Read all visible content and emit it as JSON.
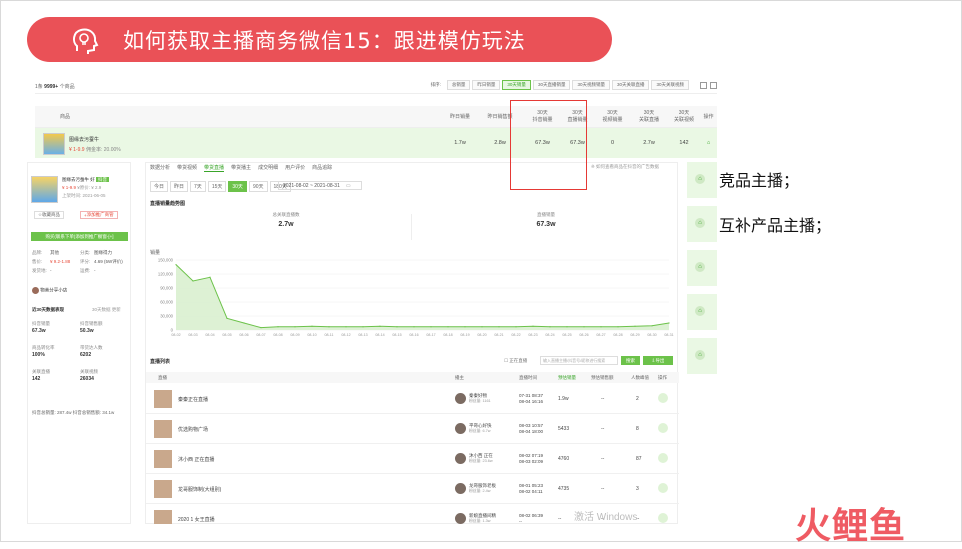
{
  "title": "如何获取主播商务微信15：跟进模仿玩法",
  "side_notes": [
    "竞品主播；",
    "互补产品主播；"
  ],
  "logo_text": "火鲤鱼",
  "watermark": "激活 Windows",
  "top_table": {
    "count_label": "1条",
    "count_value": "9999+",
    "count_suffix": "个商品",
    "sort_label": "排序:",
    "sort_tabs": [
      "总销量",
      "昨日销量",
      "30天销量",
      "30天直播销量",
      "30天视频销量",
      "30天关联直播",
      "30天关联视频"
    ],
    "active_sort": "30天销量",
    "headers": [
      "商品",
      "昨日销量",
      "昨日销售额",
      "30天\n抖音销量",
      "30天\n直播销量",
      "30天\n视频销量",
      "30天\n关联直播",
      "30天\n关联视频",
      "操作"
    ],
    "row": {
      "name": "图缘去污蚕牛",
      "price": "¥ 1-9.9",
      "commission": "佣金率: 20.00%",
      "values": [
        "1.7w",
        "2.8w",
        "67.3w",
        "67.3w",
        "0",
        "2.7w",
        "142"
      ]
    }
  },
  "left_panel": {
    "product_name": "图缘去污蚕牛 好",
    "badge": "抖音",
    "price": "¥ 1-9.9",
    "price_ref": "¥原价: ¥ 2.9",
    "listing": "上架时间: 2021-06-05",
    "fav_label": "收藏商品",
    "promo_label": "添加推广商管",
    "green_bar": "购买(联系下单)添加到推广橱窗-[+]",
    "rows": [
      [
        "品牌:",
        "其他",
        "分类:",
        "图缘得力"
      ],
      [
        "售价:",
        "¥ 9.2-1.88",
        "评分:",
        "4.69 (5W评价)"
      ],
      [
        "发货地:",
        "-",
        "运费:",
        "-"
      ]
    ],
    "shop": "物美分享小店",
    "section_title": "近30天数据表现",
    "section_note": "30天数据 更新",
    "stats": [
      {
        "label": "抖音销量",
        "value": "67.3w"
      },
      {
        "label": "抖音销售额",
        "value": "50.3w"
      },
      {
        "label": "商品转化率",
        "value": "100%"
      },
      {
        "label": "带货达人数",
        "value": "6202"
      },
      {
        "label": "关联直播",
        "value": "142"
      },
      {
        "label": "关联视频",
        "value": "26034"
      }
    ],
    "footer": "抖音总销量: 287.4w  抖音总销售额: 34.1w"
  },
  "center_panel": {
    "tabs": [
      "数据分析",
      "带货视频",
      "带货直播",
      "带货播主",
      "成交明细",
      "用户评价",
      "商品追踪"
    ],
    "active_tab": "带货直播",
    "hint": "※ 如何查看商品在抖音的广告数据",
    "date_buttons": [
      "今日",
      "昨日",
      "7天",
      "15天",
      "30天",
      "90天",
      "180天"
    ],
    "active_date": "30天",
    "date_range": "2021-08-02  ~  2021-08-31",
    "chart_title": "直播销量趋势图",
    "stat_a_label": "总关联直播数",
    "stat_a_value": "2.7w",
    "stat_b_label": "直播销量",
    "stat_b_value": "67.3w",
    "list_title": "直播列表",
    "live_filter": "正在直播",
    "search_placeholder": "输入直播主播/抖音号/昵称进行搜索",
    "search_btn": "搜索",
    "export_btn": "导出",
    "list_headers": [
      "直播",
      "播主",
      "直播时间",
      "预估销量",
      "预估销售额",
      "人数峰值",
      "操作"
    ],
    "list_rows": [
      {
        "title": "秦秦正在直播",
        "host": "秦秦好物",
        "fans": "粉丝量: 1161",
        "time": "07-31 08:37\n08-04 16:16",
        "sales": "1.9w",
        "amount": "--",
        "peak": "2"
      },
      {
        "title": "优选购物广场",
        "host": "平哥心好快",
        "fans": "粉丝量: 6.7w",
        "time": "08-03 10:57\n08-04 18:00",
        "sales": "5433",
        "amount": "--",
        "peak": "8"
      },
      {
        "title": "沐小西 正在直播",
        "host": "沐小西 正在",
        "fans": "粉丝量: 23.6w",
        "time": "08-02 07:19\n08-03 02:09",
        "sales": "4760",
        "amount": "--",
        "peak": "87"
      },
      {
        "title": "龙哥服饰制(大组别)",
        "host": "龙哥服饰老板",
        "fans": "粉丝量: 2.4w",
        "time": "08-01 05:23\n08-02 04:11",
        "sales": "4735",
        "amount": "--",
        "peak": "3"
      },
      {
        "title": "2020 1 女王直播",
        "host": "新娘直播间精",
        "fans": "粉丝量: 1.3w",
        "time": "08-02 06:39\n--",
        "sales": "--",
        "amount": "--",
        "peak": "--"
      }
    ]
  },
  "chart_data": {
    "type": "area",
    "title": "直播销量趋势图",
    "ylabel": "销量",
    "ylim": [
      0,
      150000
    ],
    "yticks": [
      "150,000",
      "120,000",
      "90,000",
      "60,000",
      "30,000",
      "0"
    ],
    "x": [
      "08-02",
      "08-03",
      "08-04",
      "08-05",
      "08-06",
      "08-07",
      "08-08",
      "08-09",
      "08-10",
      "08-11",
      "08-12",
      "08-13",
      "08-14",
      "08-15",
      "08-16",
      "08-17",
      "08-18",
      "08-19",
      "08-20",
      "08-21",
      "08-22",
      "08-23",
      "08-24",
      "08-25",
      "08-26",
      "08-27",
      "08-28",
      "08-29",
      "08-30",
      "08-31"
    ],
    "values": [
      140000,
      105000,
      113000,
      25000,
      15000,
      5000,
      7000,
      7000,
      8000,
      7000,
      7000,
      7000,
      8000,
      7000,
      7000,
      7000,
      7000,
      7000,
      7000,
      7000,
      7000,
      8000,
      7000,
      7000,
      7000,
      7000,
      7000,
      8000,
      9000,
      15000
    ],
    "color": "#6cc24a"
  },
  "colors": {
    "accent": "#ea5157",
    "green": "#6cc24a",
    "highlight_box": "#e53935"
  }
}
